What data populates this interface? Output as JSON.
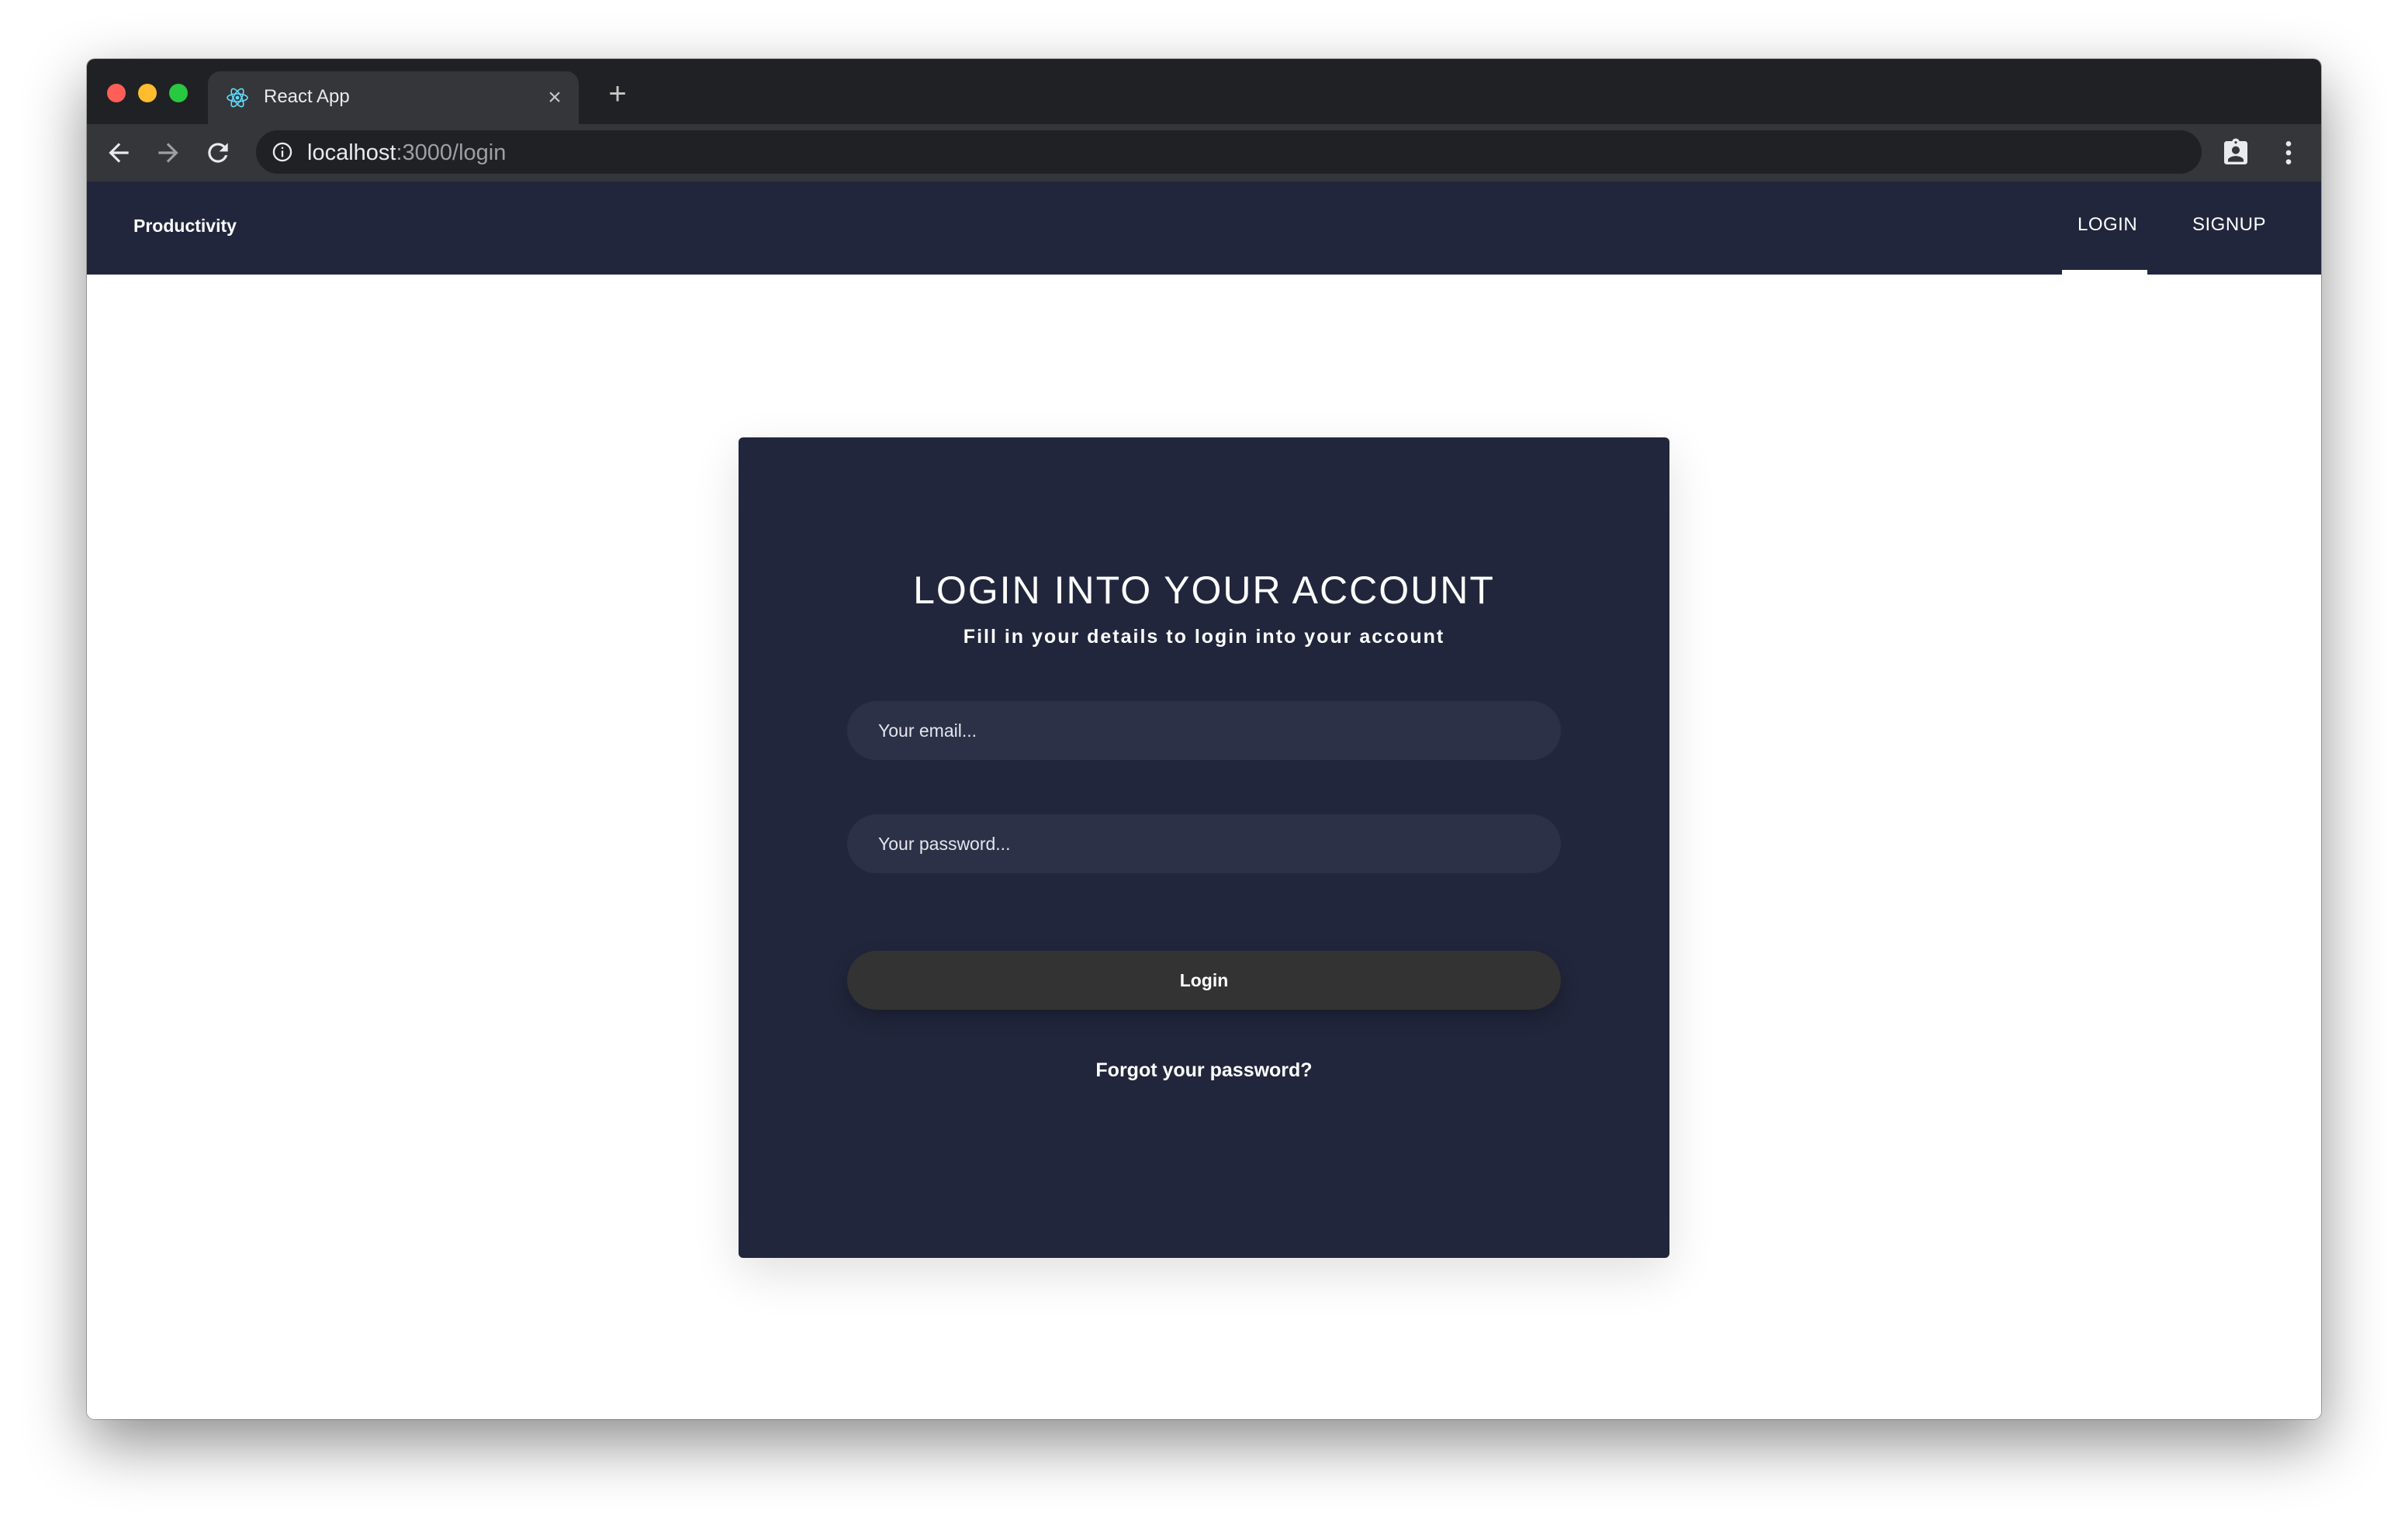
{
  "browser": {
    "tab_title": "React App",
    "url_host": "localhost",
    "url_path": ":3000/login",
    "icons": [
      "react-favicon",
      "close-icon",
      "plus-icon",
      "back-arrow-icon",
      "forward-arrow-icon",
      "reload-icon",
      "info-icon",
      "profile-badge-icon",
      "kebab-menu-icon"
    ]
  },
  "navbar": {
    "brand": "Productivity",
    "links": [
      {
        "label": "LOGIN",
        "active": true
      },
      {
        "label": "SIGNUP",
        "active": false
      }
    ]
  },
  "login_card": {
    "title": "LOGIN INTO YOUR ACCOUNT",
    "subtitle": "Fill in your details to login into your account",
    "email_placeholder": "Your email...",
    "email_value": "",
    "password_placeholder": "Your password...",
    "password_value": "",
    "submit_label": "Login",
    "forgot_label": "Forgot your password?"
  },
  "colors": {
    "navbar_bg": "#21263c",
    "card_bg": "#21263c",
    "input_bg": "#2c3148",
    "button_bg": "#333333",
    "chrome_dark": "#202124",
    "chrome_toolbar": "#35363a"
  }
}
